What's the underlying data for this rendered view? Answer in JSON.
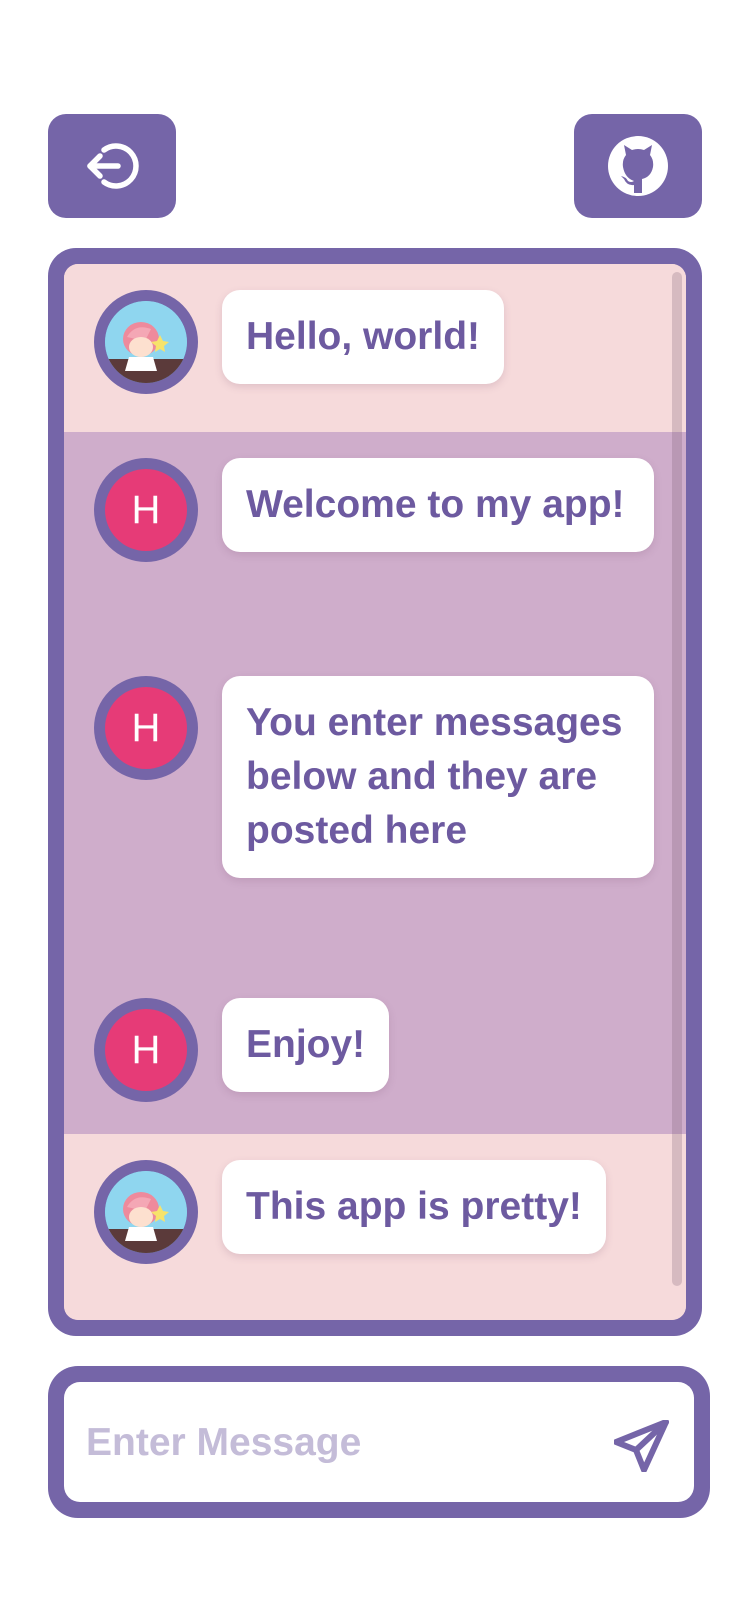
{
  "header": {
    "logout_button_icon": "logout-icon",
    "github_button_icon": "github-icon"
  },
  "colors": {
    "primary": "#7565a8",
    "self_message_bg": "#cfadcb",
    "other_message_bg": "#f6dadb",
    "avatar_initial_bg": "#e63b77",
    "bubble_text": "#6d5aa0",
    "placeholder_text": "#c4bcd8"
  },
  "messages": [
    {
      "sender": "other",
      "avatar": "avatar-image",
      "text": "Hello, world!"
    },
    {
      "sender": "self",
      "avatar_initial": "H",
      "text": "Welcome to my app!"
    },
    {
      "sender": "self",
      "avatar_initial": "H",
      "text": "You enter messages below and they are posted here"
    },
    {
      "sender": "self",
      "avatar_initial": "H",
      "text": "Enjoy!"
    },
    {
      "sender": "other",
      "avatar": "avatar-image",
      "text": "This app is pretty!"
    }
  ],
  "composer": {
    "placeholder": "Enter Message",
    "value": "",
    "send_icon": "send-icon"
  }
}
